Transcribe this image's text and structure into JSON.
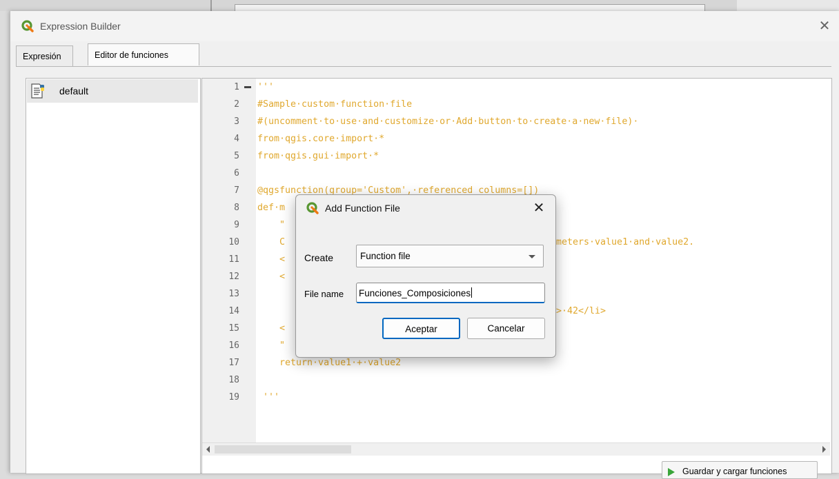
{
  "window": {
    "title": "Expression Builder",
    "close_glyph": "✕"
  },
  "tabs": [
    {
      "label": "Expresión",
      "active": false
    },
    {
      "label": "Editor de funciones",
      "active": true
    }
  ],
  "file_list": {
    "items": [
      {
        "label": "default",
        "icon": "python-file-icon"
      }
    ]
  },
  "editor": {
    "line_numbers": [
      "1",
      "2",
      "3",
      "4",
      "5",
      "6",
      "7",
      "8",
      "9",
      "10",
      "11",
      "12",
      "13",
      "14",
      "15",
      "16",
      "17",
      "18",
      "19"
    ],
    "visible_code": [
      {
        "line": 1,
        "text": "'''"
      },
      {
        "line": 2,
        "text": "#Sample·custom·function·file"
      },
      {
        "line": 3,
        "text": "#(uncomment·to·use·and·customize·or·Add·button·to·create·a·new·file)·"
      },
      {
        "line": 4,
        "text": "from·qgis.core·import·*"
      },
      {
        "line": 5,
        "text": "from·qgis.gui·import·*"
      },
      {
        "line": 7,
        "text": "@qgsfunction(group='Custom',·referenced_columns=[])"
      },
      {
        "line": 8,
        "text": "def·m"
      },
      {
        "line": 9,
        "text": "    \""
      },
      {
        "line": 10,
        "text": "    C",
        "suffix": "meters·value1·and·value2."
      },
      {
        "line": 11,
        "text": "    <"
      },
      {
        "line": 12,
        "text": "    <"
      },
      {
        "line": 14,
        "text": "",
        "suffix": ">·42</li>"
      },
      {
        "line": 15,
        "text": "    <"
      },
      {
        "line": 16,
        "text": "    \""
      },
      {
        "line": 17,
        "text": "    return·value1·+·value2"
      },
      {
        "line": 19,
        "text": " '''"
      }
    ],
    "code_color": "#e0a82e"
  },
  "save_button": {
    "label": "Guardar y cargar funciones"
  },
  "dialog": {
    "title": "Add Function File",
    "close_glyph": "✕",
    "create_label": "Create",
    "create_value": "Function file",
    "filename_label": "File name",
    "filename_value": "Funciones_Composiciones",
    "ok_label": "Aceptar",
    "cancel_label": "Cancelar",
    "accent": "#0067c0"
  }
}
